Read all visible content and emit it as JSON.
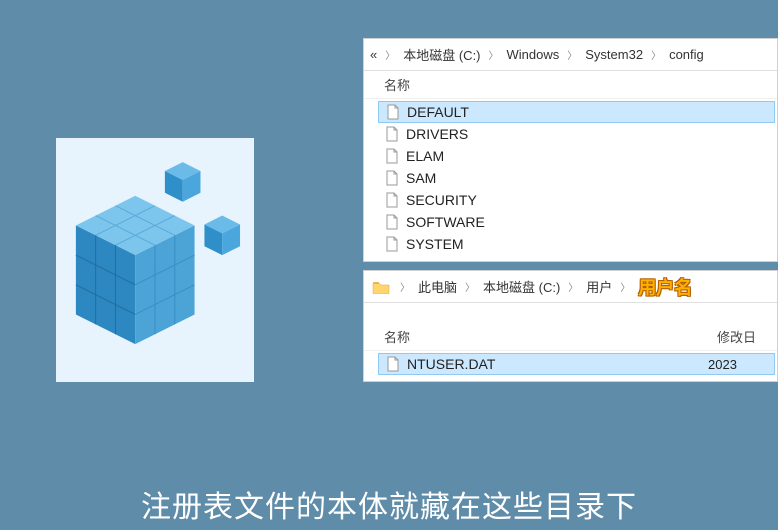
{
  "breadcrumb1": {
    "prefix": "«",
    "parts": [
      "本地磁盘 (C:)",
      "Windows",
      "System32",
      "config"
    ]
  },
  "breadcrumb2": {
    "parts": [
      "此电脑",
      "本地磁盘 (C:)",
      "用户",
      "用户名"
    ],
    "emphIndex": 3
  },
  "columns": {
    "name": "名称",
    "date": "修改日"
  },
  "files1": [
    {
      "name": "DEFAULT",
      "selected": true
    },
    {
      "name": "DRIVERS",
      "selected": false
    },
    {
      "name": "ELAM",
      "selected": false
    },
    {
      "name": "SAM",
      "selected": false
    },
    {
      "name": "SECURITY",
      "selected": false
    },
    {
      "name": "SOFTWARE",
      "selected": false
    },
    {
      "name": "SYSTEM",
      "selected": false
    }
  ],
  "files2": [
    {
      "name": "NTUSER.DAT",
      "date": "2023",
      "selected": true
    }
  ],
  "caption": "注册表文件的本体就藏在这些目录下"
}
